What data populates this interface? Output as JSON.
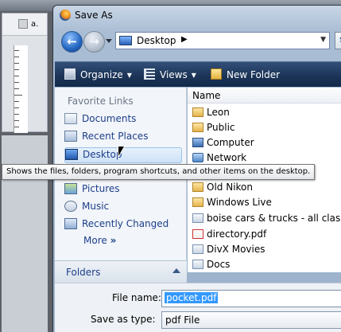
{
  "background_app": {
    "tab_label": "a."
  },
  "dialog": {
    "title": "Save As",
    "address": {
      "location": "Desktop"
    },
    "toolbar": {
      "organize": "Organize",
      "views": "Views",
      "new_folder": "New Folder"
    },
    "favorites": {
      "title": "Favorite Links",
      "items": [
        {
          "label": "Documents",
          "icon": "documents-icon"
        },
        {
          "label": "Recent Places",
          "icon": "recent-places-icon"
        },
        {
          "label": "Desktop",
          "icon": "desktop-icon",
          "selected": true
        },
        {
          "label": "Pictures",
          "icon": "pictures-icon"
        },
        {
          "label": "Music",
          "icon": "music-icon"
        },
        {
          "label": "Recently Changed",
          "icon": "recently-changed-icon"
        }
      ],
      "more": "More"
    },
    "folders_label": "Folders",
    "file_list": {
      "column": "Name",
      "items": [
        {
          "name": "Leon",
          "icon": "folder"
        },
        {
          "name": "Public",
          "icon": "folder"
        },
        {
          "name": "Computer",
          "icon": "computer"
        },
        {
          "name": "Network",
          "icon": "network"
        },
        {
          "name": "Old Nikon",
          "icon": "folder"
        },
        {
          "name": "Windows Live",
          "icon": "folder"
        },
        {
          "name": "boise cars & trucks - all classifie",
          "icon": "link"
        },
        {
          "name": "directory.pdf",
          "icon": "pdf"
        },
        {
          "name": "DivX Movies",
          "icon": "link"
        },
        {
          "name": "Docs",
          "icon": "link"
        }
      ]
    },
    "file_name_label": "File name:",
    "file_name_value": "pocket.pdf",
    "save_type_label": "Save as type:",
    "save_type_value": "pdf File"
  },
  "tooltip": "Shows the files, folders, program shortcuts, and other items on the desktop."
}
